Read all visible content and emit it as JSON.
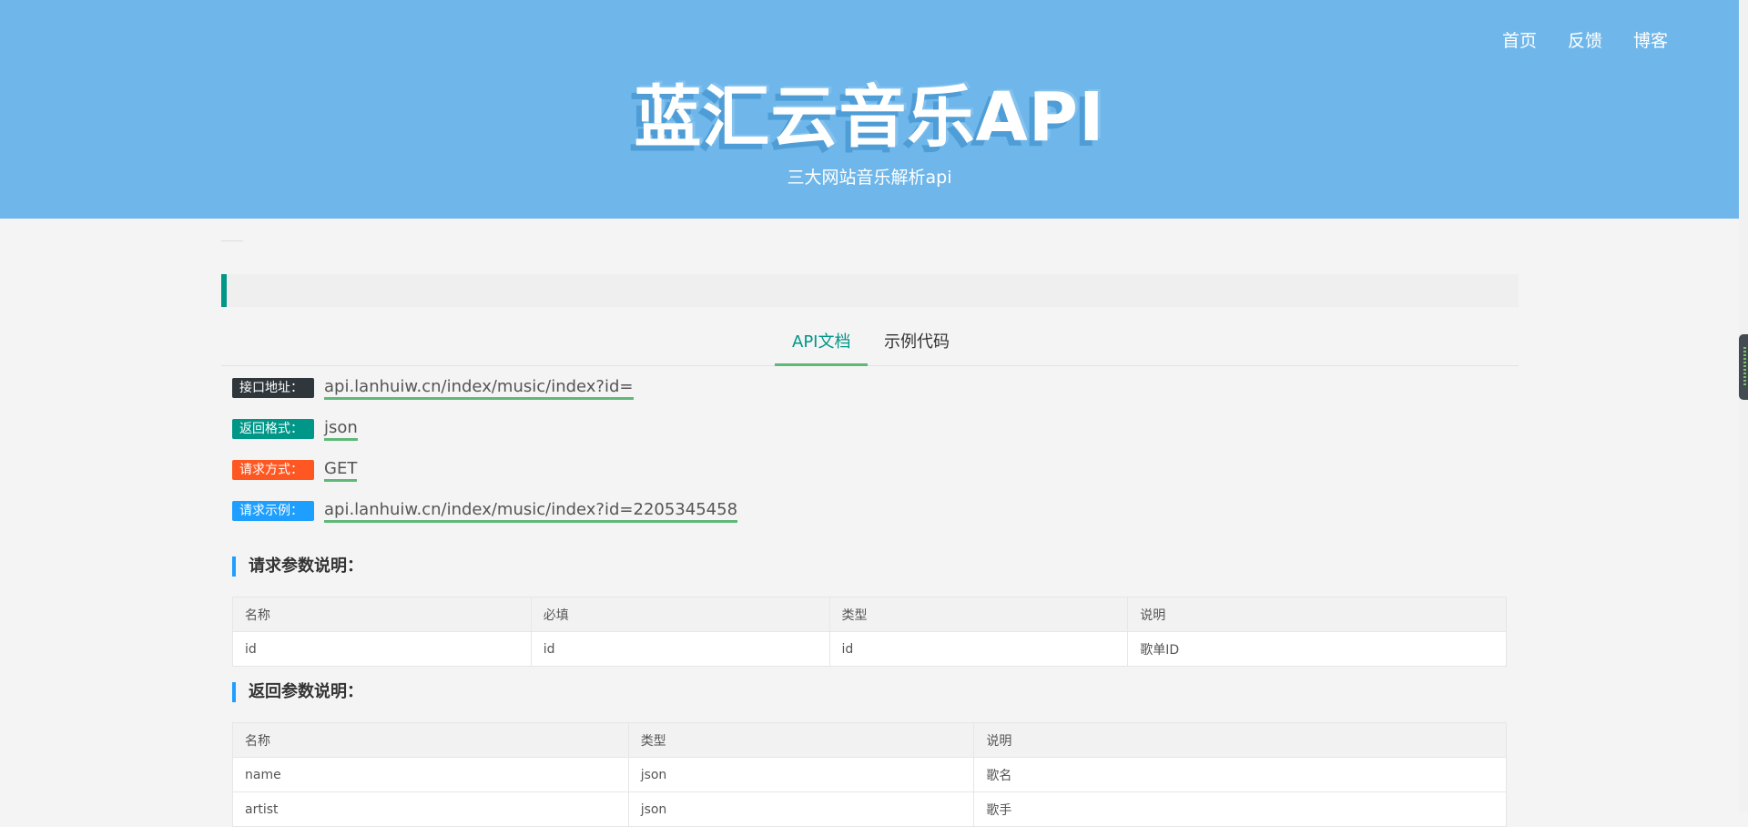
{
  "nav": {
    "items": [
      "首页",
      "反馈",
      "博客"
    ]
  },
  "hero": {
    "title": "蓝汇云音乐API",
    "subtitle": "三大网站音乐解析api"
  },
  "tabs": [
    "API文档",
    "示例代码"
  ],
  "info": [
    {
      "label": "接口地址：",
      "value": "api.lanhuiw.cn/index/music/index?id=",
      "color": "#2f363c"
    },
    {
      "label": "返回格式：",
      "value": "json",
      "color": "#009688"
    },
    {
      "label": "请求方式：",
      "value": "GET",
      "color": "#ff5722"
    },
    {
      "label": "请求示例：",
      "value": "api.lanhuiw.cn/index/music/index?id=2205345458",
      "color": "#1e9fff"
    }
  ],
  "request_params": {
    "title": "请求参数说明：",
    "headers": [
      "名称",
      "必填",
      "类型",
      "说明"
    ],
    "rows": [
      [
        "id",
        "id",
        "id",
        "歌单ID"
      ]
    ]
  },
  "return_params": {
    "title": "返回参数说明：",
    "headers": [
      "名称",
      "类型",
      "说明"
    ],
    "rows": [
      [
        "name",
        "json",
        "歌名"
      ],
      [
        "artist",
        "json",
        "歌手"
      ]
    ]
  },
  "colors": {
    "hero_bg": "#6fb7ea",
    "accent_green": "#009688",
    "underline_green": "#5fb878",
    "section_blue": "#1e9fff"
  }
}
